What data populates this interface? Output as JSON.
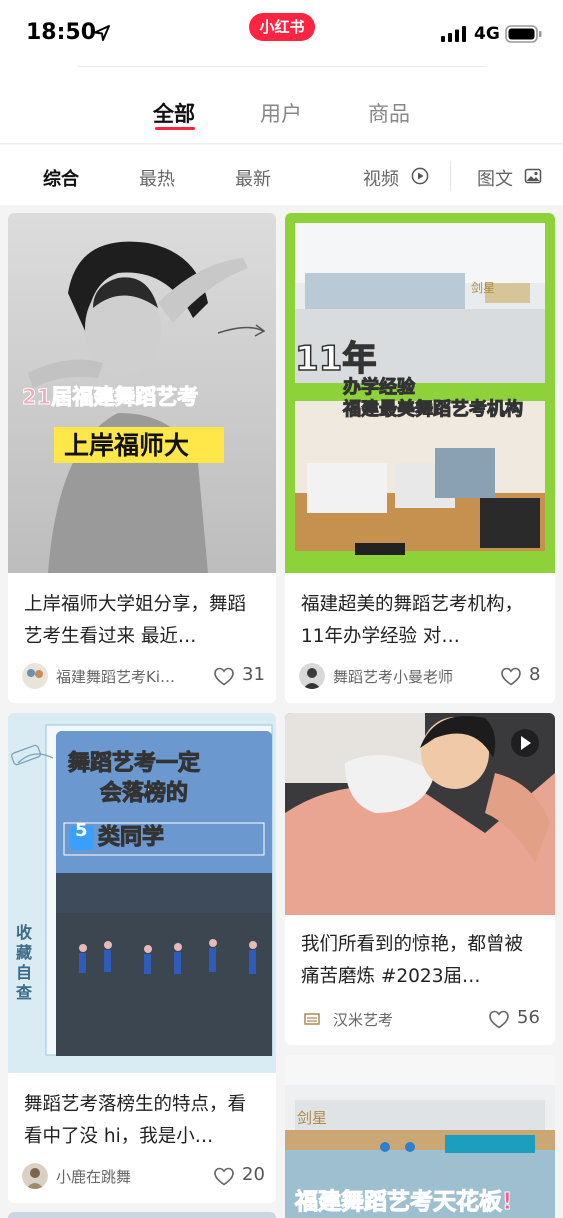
{
  "status_bar": {
    "time": "18:50",
    "network": "4G"
  },
  "app_logo": "小红书",
  "tabs": [
    {
      "label": "全部",
      "active": true
    },
    {
      "label": "用户",
      "active": false
    },
    {
      "label": "商品",
      "active": false
    }
  ],
  "filters": [
    {
      "label": "综合",
      "active": true
    },
    {
      "label": "最热"
    },
    {
      "label": "最新"
    },
    {
      "label": "视频",
      "icon": "play-circle-icon"
    },
    {
      "label": "图文",
      "icon": "image-icon"
    }
  ],
  "cards": [
    {
      "overlay": [
        "21届福建舞蹈艺考",
        "上岸福师大"
      ],
      "title": "上岸福师大学姐分享，舞蹈艺考生看过来 最近…",
      "author": "福建舞蹈艺考Ki…",
      "likes": "31"
    },
    {
      "overlay": [
        "11年",
        "办学经验",
        "福建最美舞蹈艺考机构",
        "剑星"
      ],
      "title": "福建超美的舞蹈艺考机构，11年办学经验 对…",
      "author": "舞蹈艺考小曼老师",
      "likes": "8"
    },
    {
      "overlay": [
        "舞蹈艺考一定",
        "会落榜的",
        "5",
        "类同学",
        "收藏自查"
      ],
      "title": "舞蹈艺考落榜生的特点，看看中了没 hi，我是小…",
      "author": "小鹿在跳舞",
      "likes": "20"
    },
    {
      "overlay": [],
      "title": "我们所看到的惊艳，都曾被痛苦磨炼 #2023届…",
      "author": "汉米艺考",
      "likes": "56",
      "is_video": true
    },
    {
      "overlay": [
        "福建舞蹈艺考天花板!",
        "剑星"
      ]
    }
  ],
  "colors": {
    "brand": "#ff2442",
    "card_green": "#8ed23a"
  }
}
